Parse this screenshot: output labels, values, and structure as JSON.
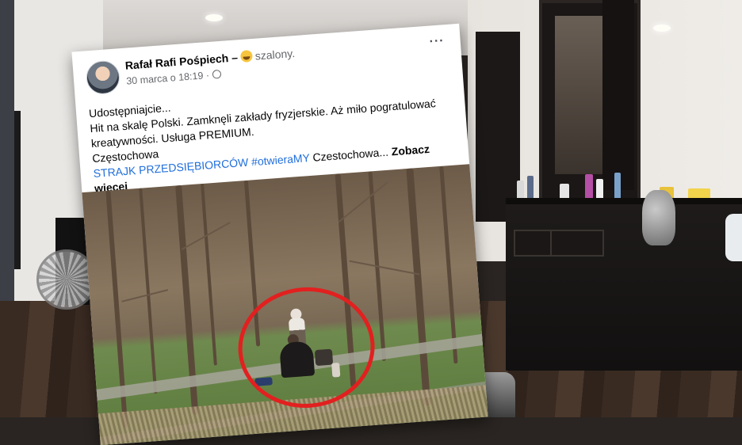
{
  "post": {
    "author": "Rafał Rafi Pośpiech",
    "separator": "–",
    "feeling": "szalony.",
    "timestamp": "30 marca o 18:19 ·",
    "more_label": "···",
    "lines": [
      "Udostępniajcie...",
      "Hit na skalę Polski. Zamknęli zakłady fryzjerskie. Aż miło pogratulować",
      "kreatywności. Usługa PREMIUM."
    ],
    "city": "Częstochowa",
    "hashtags": "STRAJK PRZEDSIĘBIORCÓW #otwieraMY",
    "hashtag_suffix": " Czestochowa...",
    "see_more": "Zobacz więcej"
  },
  "colors": {
    "highlight": "#e2201f",
    "link": "#216fdb",
    "meta_text": "#65676b"
  },
  "icons": {
    "feeling": "grinning-face-icon",
    "privacy": "globe-icon",
    "more": "more-options-icon"
  }
}
